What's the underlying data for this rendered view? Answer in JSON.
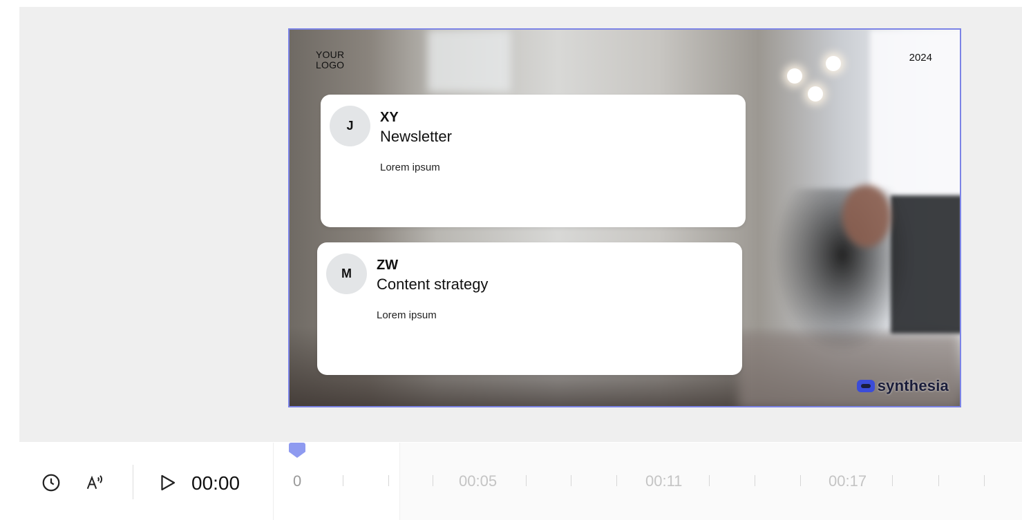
{
  "canvas": {
    "logo_text": "YOUR LOGO",
    "year": "2024",
    "brand": "synthesia",
    "cards": [
      {
        "initial": "J",
        "title": "XY",
        "subtitle": "Newsletter",
        "body": "Lorem ipsum"
      },
      {
        "initial": "M",
        "title": "ZW",
        "subtitle": "Content strategy",
        "body": "Lorem ipsum"
      }
    ],
    "accent_color": "#7b83e6"
  },
  "controls": {
    "icons": [
      "clock-icon",
      "voice-icon",
      "play-icon"
    ],
    "current_time": "00:00"
  },
  "timeline": {
    "labels": [
      "0",
      "00:05",
      "00:11",
      "00:17"
    ],
    "playhead_color": "#8e9af0"
  }
}
